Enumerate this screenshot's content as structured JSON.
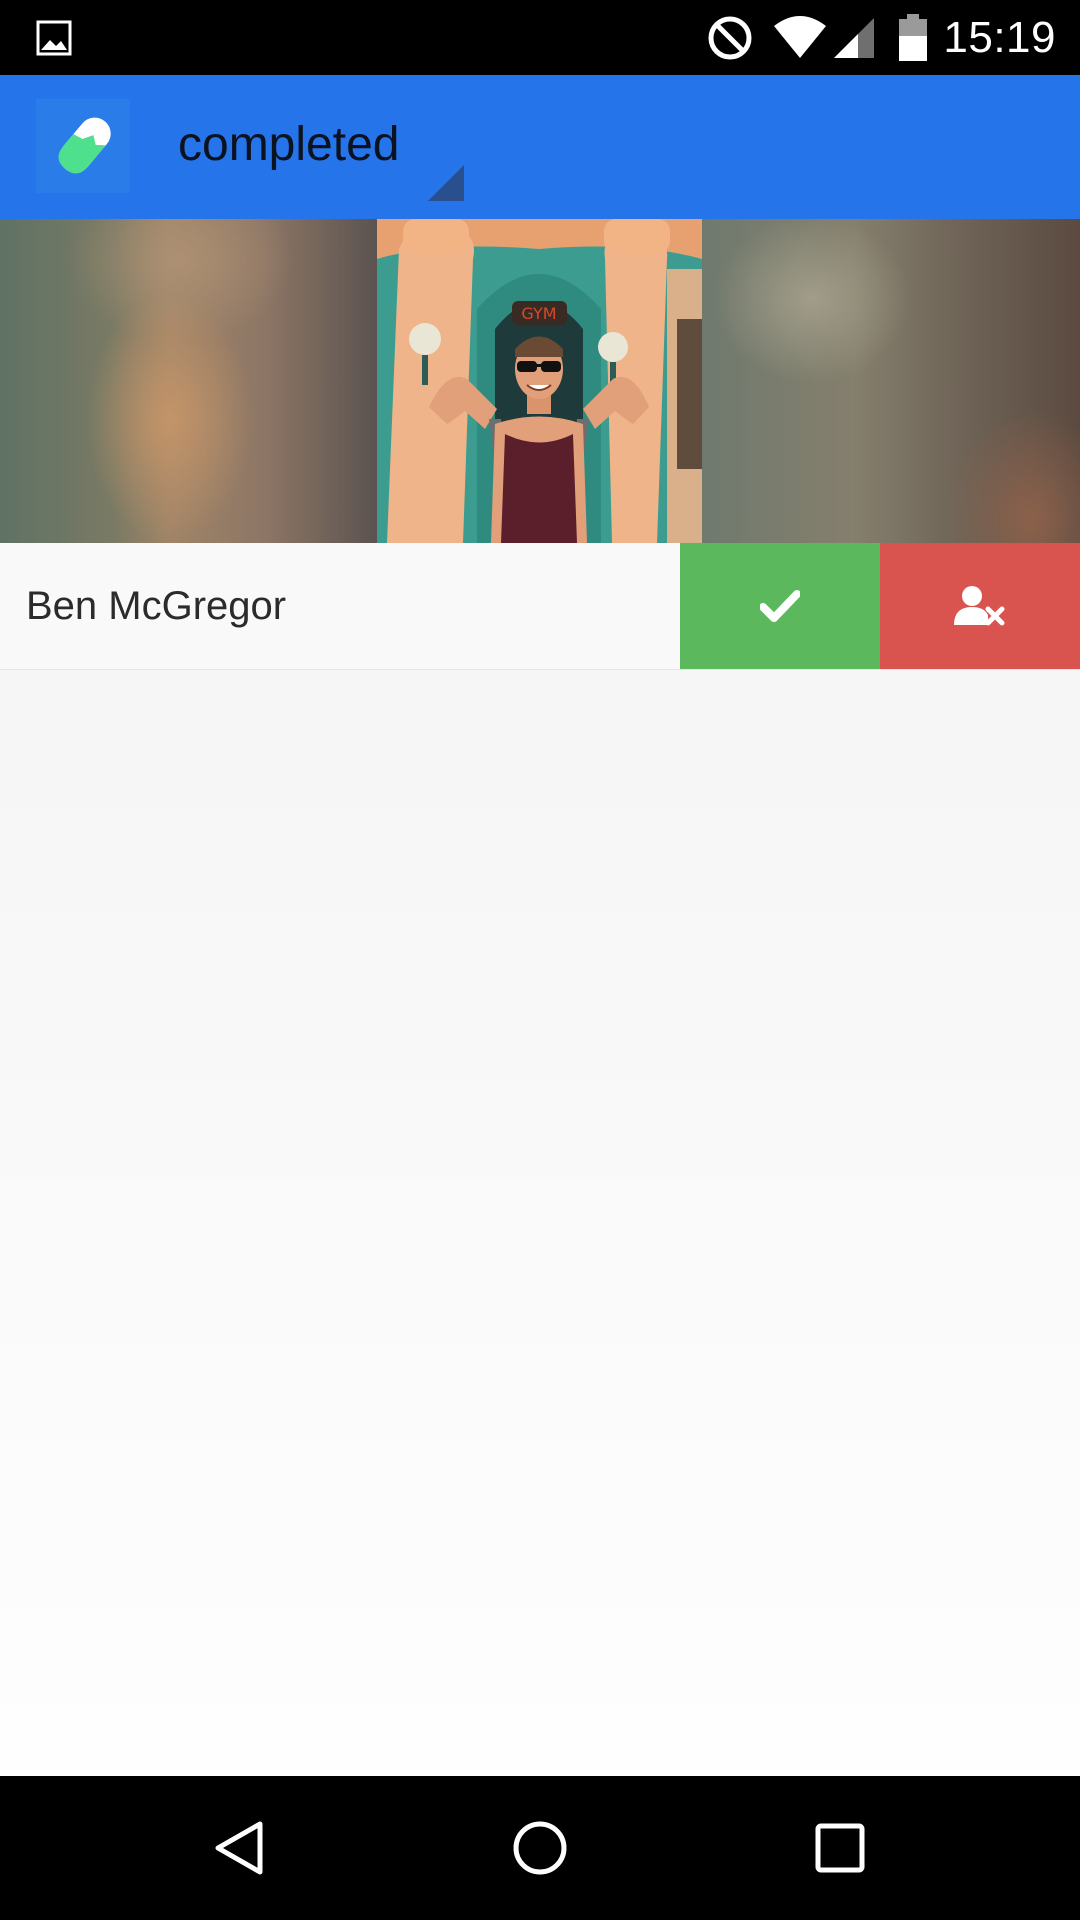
{
  "status_bar": {
    "time": "15:19",
    "icons": [
      "image-notification-icon",
      "do-not-disturb-icon",
      "wifi-icon",
      "cell-signal-icon",
      "battery-icon"
    ]
  },
  "app_bar": {
    "logo_icon": "pill-logo-icon",
    "filter_selected": "completed",
    "background_color": "#2574e9"
  },
  "match": {
    "name": "Ben McGregor",
    "accept_icon": "check-icon",
    "reject_icon": "user-remove-icon",
    "accept_color": "#5cb85c",
    "reject_color": "#d9534f"
  },
  "nav_bar": {
    "icons": [
      "back-icon",
      "home-icon",
      "recents-icon"
    ]
  }
}
